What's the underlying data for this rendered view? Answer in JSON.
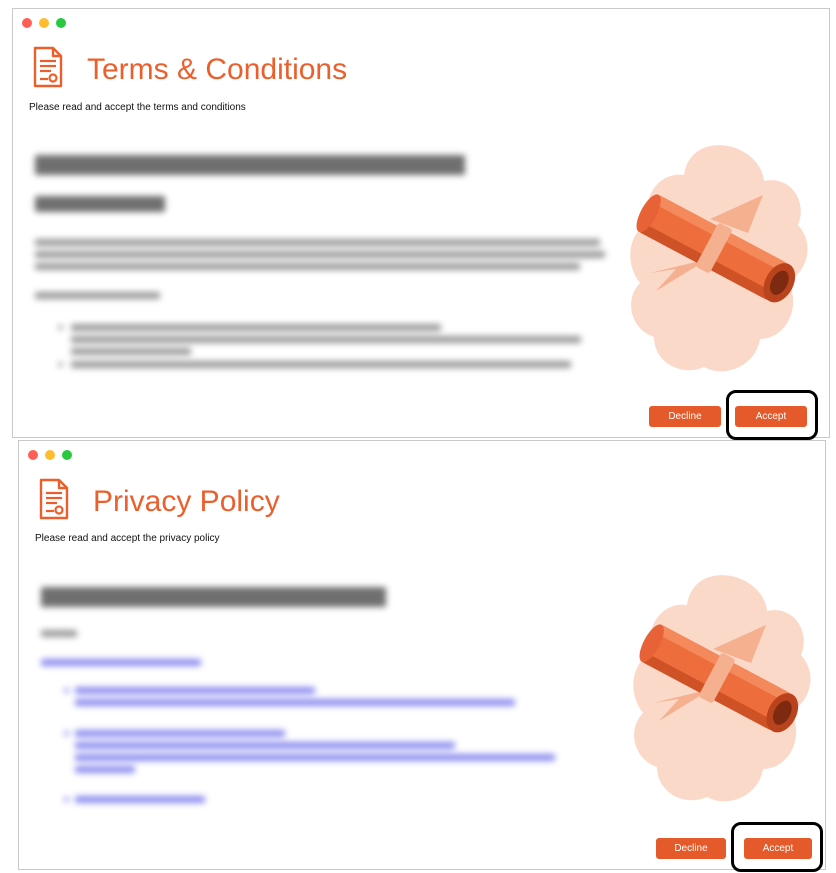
{
  "windows": [
    {
      "title": "Terms & Conditions",
      "subtitle": "Please read and accept the terms and conditions",
      "decline_label": "Decline",
      "accept_label": "Accept"
    },
    {
      "title": "Privacy Policy",
      "subtitle": "Please read and accept the privacy policy",
      "decline_label": "Decline",
      "accept_label": "Accept"
    }
  ],
  "colors": {
    "accent": "#ec5f2c",
    "button": "#e45a2a",
    "illustration_bg": "#fbd9c9",
    "scroll_primary": "#ed6d3d",
    "scroll_dark": "#b8431d",
    "ribbon": "#f5b08f",
    "link_blur": "#8c8cf0"
  }
}
